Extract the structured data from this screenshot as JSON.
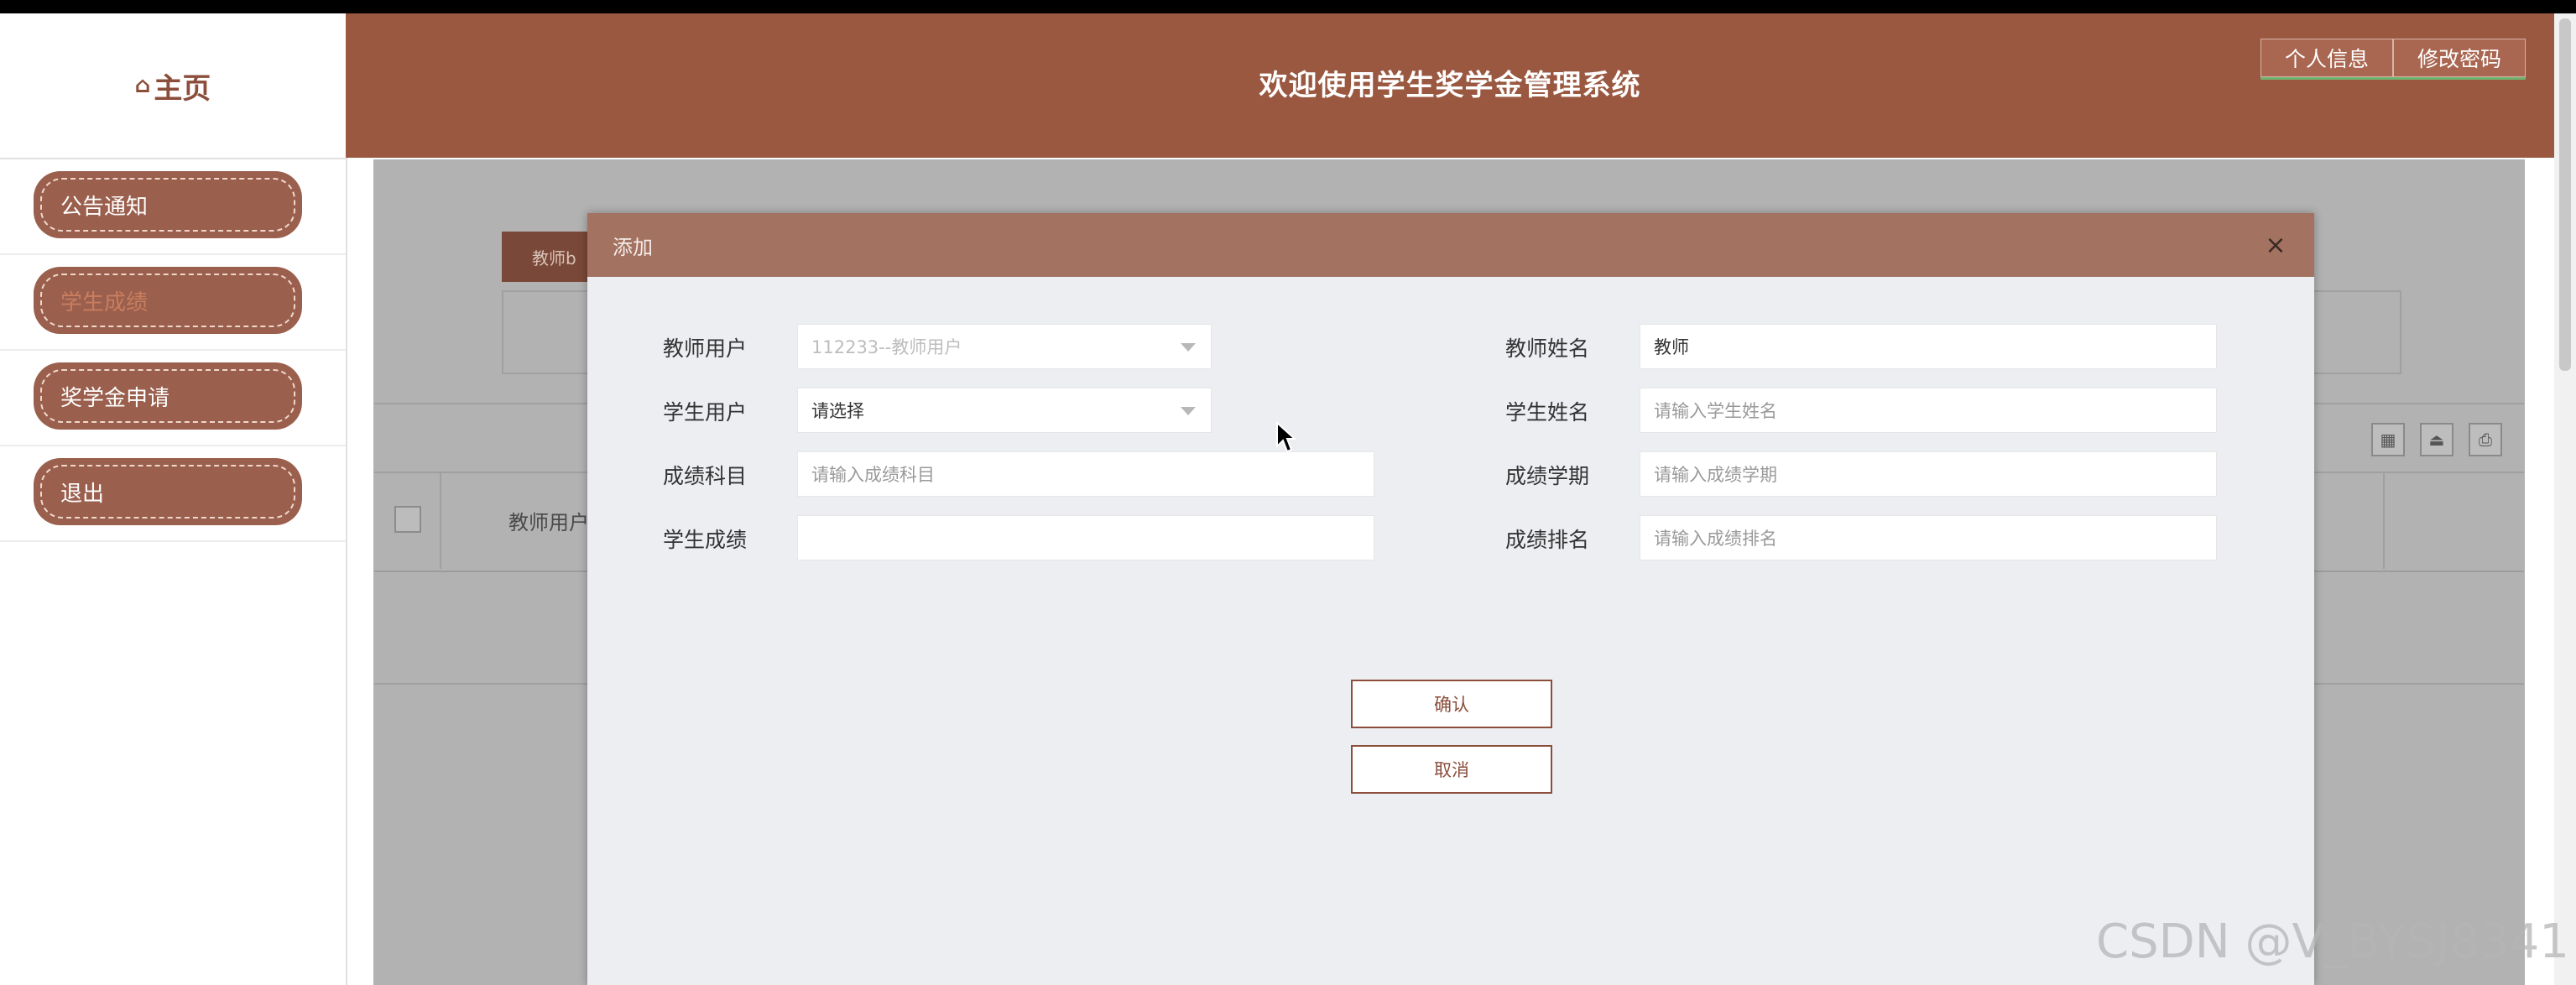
{
  "app": {
    "title": "欢迎使用学生奖学金管理系统",
    "home_label": "主页",
    "header_buttons": [
      "个人信息",
      "修改密码"
    ]
  },
  "sidebar": {
    "items": [
      {
        "label": "公告通知",
        "active": false
      },
      {
        "label": "学生成绩",
        "active": true
      },
      {
        "label": "奖学金申请",
        "active": false
      },
      {
        "label": "退出",
        "active": false
      }
    ]
  },
  "background": {
    "tab_label": "教师b",
    "column_header": "教师用户"
  },
  "modal": {
    "title": "添加",
    "close_symbol": "×",
    "fields": {
      "teacher_user": {
        "label": "教师用户",
        "value": "112233--教师用户",
        "disabled": true
      },
      "teacher_name": {
        "label": "教师姓名",
        "value": "教师"
      },
      "student_user": {
        "label": "学生用户",
        "value": "请选择"
      },
      "student_name": {
        "label": "学生姓名",
        "placeholder": "请输入学生姓名"
      },
      "subject": {
        "label": "成绩科目",
        "placeholder": "请输入成绩科目"
      },
      "term": {
        "label": "成绩学期",
        "placeholder": "请输入成绩学期"
      },
      "score": {
        "label": "学生成绩",
        "placeholder": ""
      },
      "rank": {
        "label": "成绩排名",
        "placeholder": "请输入成绩排名"
      }
    },
    "confirm_label": "确认",
    "cancel_label": "取消"
  },
  "watermark": "CSDN @V_BYSJ8341",
  "colors": {
    "brand": "#9a5841",
    "modal_header": "#a37261",
    "nav_button": "#9a5f4d",
    "overlay": "#b2b2b2"
  }
}
